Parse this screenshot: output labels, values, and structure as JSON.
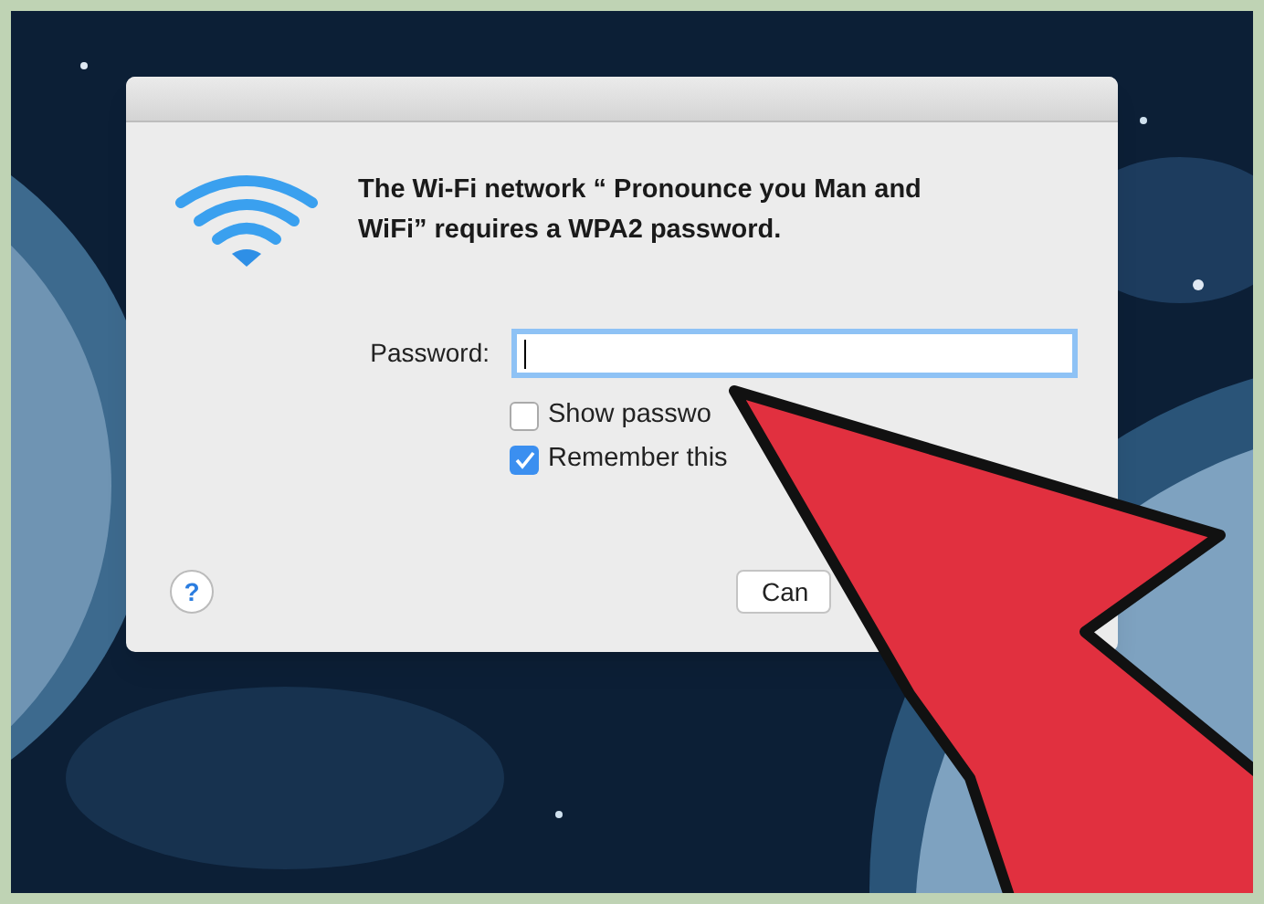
{
  "dialog": {
    "message": "The Wi-Fi network “ Pronounce you Man and WiFi” requires a WPA2 password.",
    "password": {
      "label": "Password:",
      "focused": true
    },
    "checkboxes": [
      {
        "label": "Show passwo",
        "checked": false
      },
      {
        "label": "Remember this",
        "checked": true
      }
    ],
    "help_button": "?",
    "buttons": [
      "Can"
    ]
  }
}
